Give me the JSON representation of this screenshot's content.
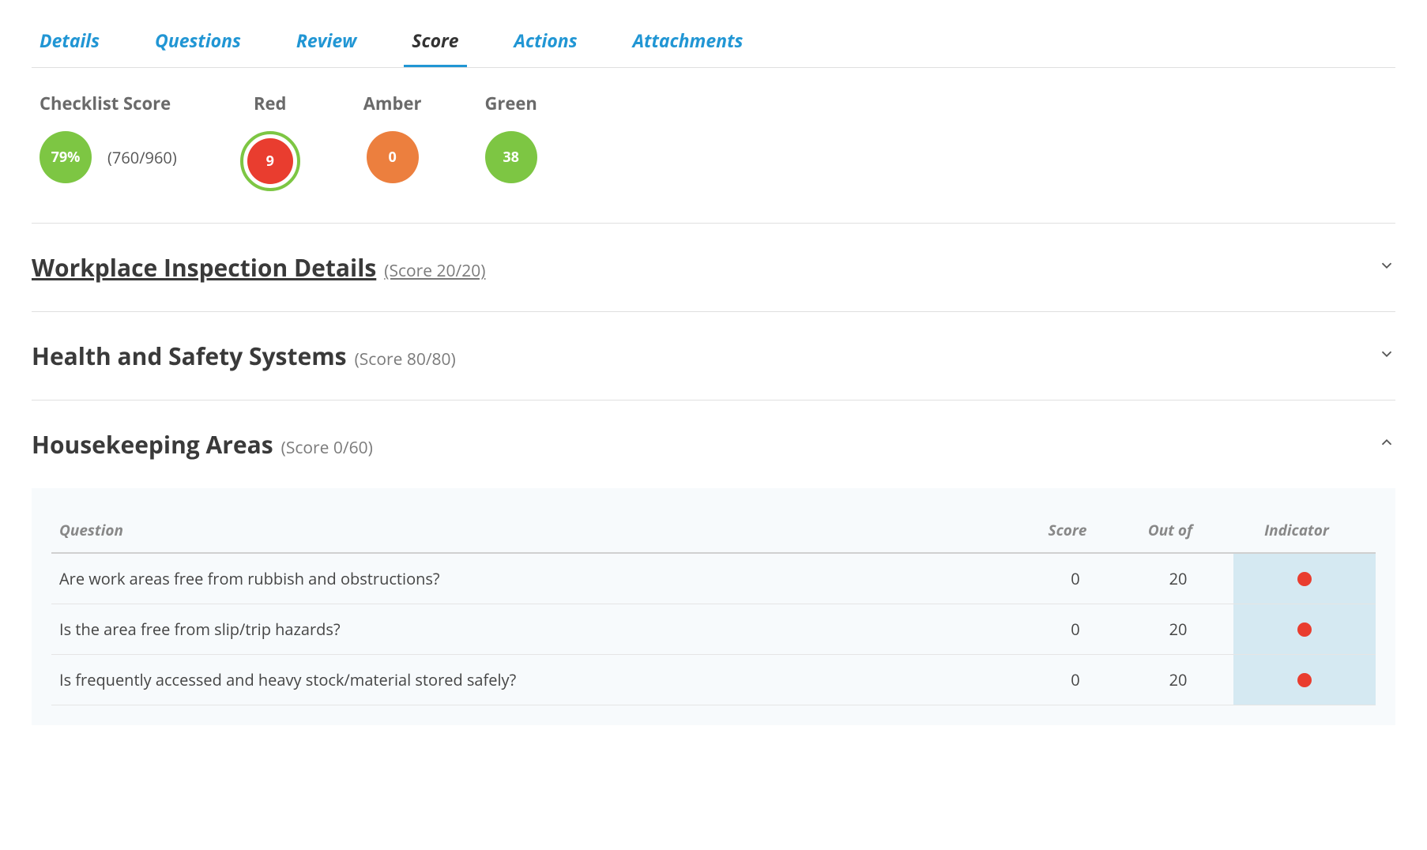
{
  "tabs": [
    {
      "label": "Details",
      "active": false
    },
    {
      "label": "Questions",
      "active": false
    },
    {
      "label": "Review",
      "active": false
    },
    {
      "label": "Score",
      "active": true
    },
    {
      "label": "Actions",
      "active": false
    },
    {
      "label": "Attachments",
      "active": false
    }
  ],
  "summary": {
    "checklist_label": "Checklist Score",
    "checklist_percent": "79%",
    "checklist_ratio": "(760/960)",
    "red_label": "Red",
    "red_count": "9",
    "amber_label": "Amber",
    "amber_count": "0",
    "green_label": "Green",
    "green_count": "38"
  },
  "sections": [
    {
      "title": "Workplace Inspection Details",
      "score_text": "(Score 20/20)",
      "underlined": true,
      "expanded": false,
      "questions": []
    },
    {
      "title": "Health and Safety Systems",
      "score_text": "(Score 80/80)",
      "underlined": false,
      "expanded": false,
      "questions": []
    },
    {
      "title": "Housekeeping Areas",
      "score_text": "(Score 0/60)",
      "underlined": false,
      "expanded": true,
      "questions": [
        {
          "text": "Are work areas free from rubbish and obstructions?",
          "score": "0",
          "out_of": "20",
          "indicator": "red"
        },
        {
          "text": "Is the area free from slip/trip hazards?",
          "score": "0",
          "out_of": "20",
          "indicator": "red"
        },
        {
          "text": "Is frequently accessed and heavy stock/material stored safely?",
          "score": "0",
          "out_of": "20",
          "indicator": "red"
        }
      ]
    }
  ],
  "table_headers": {
    "question": "Question",
    "score": "Score",
    "out_of": "Out of",
    "indicator": "Indicator"
  }
}
